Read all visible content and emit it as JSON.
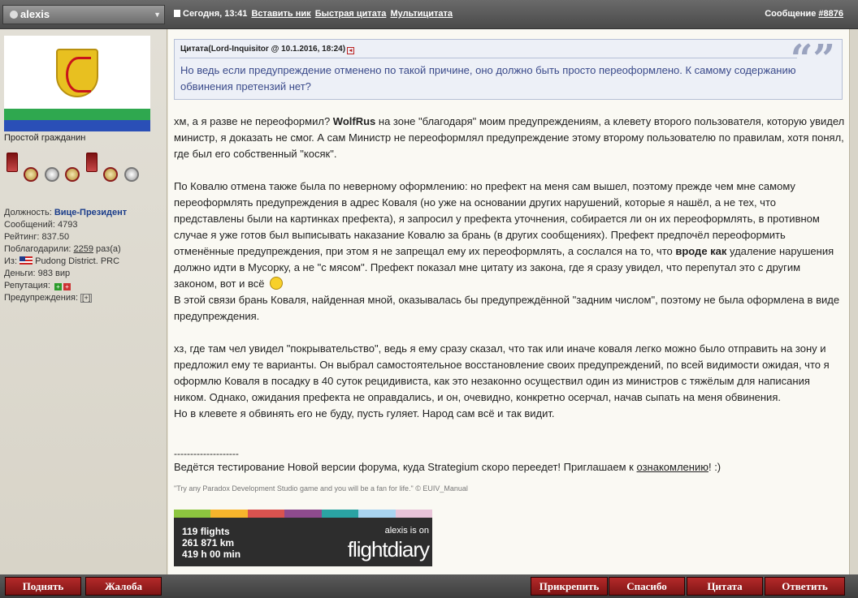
{
  "header": {
    "username": "alexis",
    "timestamp": "Сегодня, 13:41",
    "links": [
      "Вставить ник",
      "Быстрая цитата",
      "Мультицитата"
    ],
    "message_label": "Сообщение",
    "message_number": "#8876"
  },
  "user": {
    "rank": "Простой гражданин",
    "position_label": "Должность:",
    "position_value": "Вице-Президент",
    "posts": "Сообщений: 4793",
    "rating": "Рейтинг: 837.50",
    "thanked_label": "Поблагодарили:",
    "thanked_value": "2259",
    "thanked_suffix": "раз(а)",
    "from_label": "Из:",
    "from_value": "Pudong District. PRC",
    "money": "Деньги: 983 вир",
    "reputation": "Репутация:",
    "warnings": "Предупреждения:",
    "warnings_box": "[+]"
  },
  "quote": {
    "header": "Цитата(Lord-Inquisitor @ 10.1.2016, 18:24)",
    "text": "Но ведь если предупреждение отменено по такой причине, оно должно быть просто переоформлено. К самому содержанию обвинения претензий нет?"
  },
  "post": {
    "p1_a": "хм, а я разве не переоформил? ",
    "p1_bold": "WolfRus",
    "p1_b": " на зоне \"благодаря\" моим предупреждениям, а клевету второго пользователя, которую увидел министр, я доказать не смог. А сам Министр не переоформлял предупреждение этому второму пользователю по правилам, хотя понял, где был его собственный \"косяк\".",
    "p2_a": "По Ковалю отмена также была по неверному оформлению: но префект на меня сам вышел, поэтому прежде чем мне самому переоформлять предупреждения в адрес Коваля (но уже на основании других нарушений, которые я нашёл, а не тех, что представлены были на картинках префекта), я запросил у префекта уточнения, собирается ли он их переоформлять, в противном случае я уже готов был выписывать наказание Ковалю за брань (в других сообщениях). Префект предпочёл переоформить отменённые предупреждения, при этом я не запрещал ему их переоформлять, а сослался на то, что ",
    "p2_bold": "вроде как",
    "p2_b": " удаление нарушения должно идти в Мусорку, а не \"с мясом\". Префект показал мне цитату из закона, где я сразу увидел, что перепутал это с другим законом, вот и всё",
    "p3": "В этой связи брань Коваля, найденная мной, оказывалась бы предупреждённой \"задним числом\", поэтому не была оформлена в виде предупреждения.",
    "p4": "хз, где там чел увидел \"покрывательство\", ведь я ему сразу сказал, что так или иначе коваля легко можно было отправить на зону и предложил ему те варианты. Он выбрал самостоятельное восстановление своих предупреждений, по всей видимости ожидая, что я оформлю Коваля в посадку в 40 суток рецидивиста, как это незаконно осуществил один из министров с тяжёлым для написания ником. Однако, ожидания префекта не оправдались, и он, очевидно, конкретно осерчал, начав сыпать на меня обвинения.",
    "p5": "Но в клевете я обвинять его не буду, пусть гуляет. Народ сам всё и так видит."
  },
  "signature": {
    "rule": "--------------------",
    "invite_text": "Ведётся тестирование Новой версии форума, куда Strategium скоро переедет! Приглашаем к ",
    "invite_link": "ознакомлению",
    "invite_end": "! :)",
    "quote": "\"Try any Paradox Development Studio game and you will be a fan for life.\" © EUIV_Manual"
  },
  "flightdiary": {
    "flights": "119 flights",
    "distance": "261 871 km",
    "time": "419 h 00 min",
    "user_line": "alexis is on",
    "logo": "flightdiary",
    "stripe_colors": [
      "#8dc63f",
      "#f7b52c",
      "#d9534f",
      "#8e4b8e",
      "#2aa3a3",
      "#a9d4f0",
      "#e8c4d8"
    ]
  },
  "buttons": {
    "up": "Поднять",
    "complaint": "Жалоба",
    "pin": "Прикрепить",
    "thanks": "Спасибо",
    "quote": "Цитата",
    "reply": "Ответить"
  }
}
